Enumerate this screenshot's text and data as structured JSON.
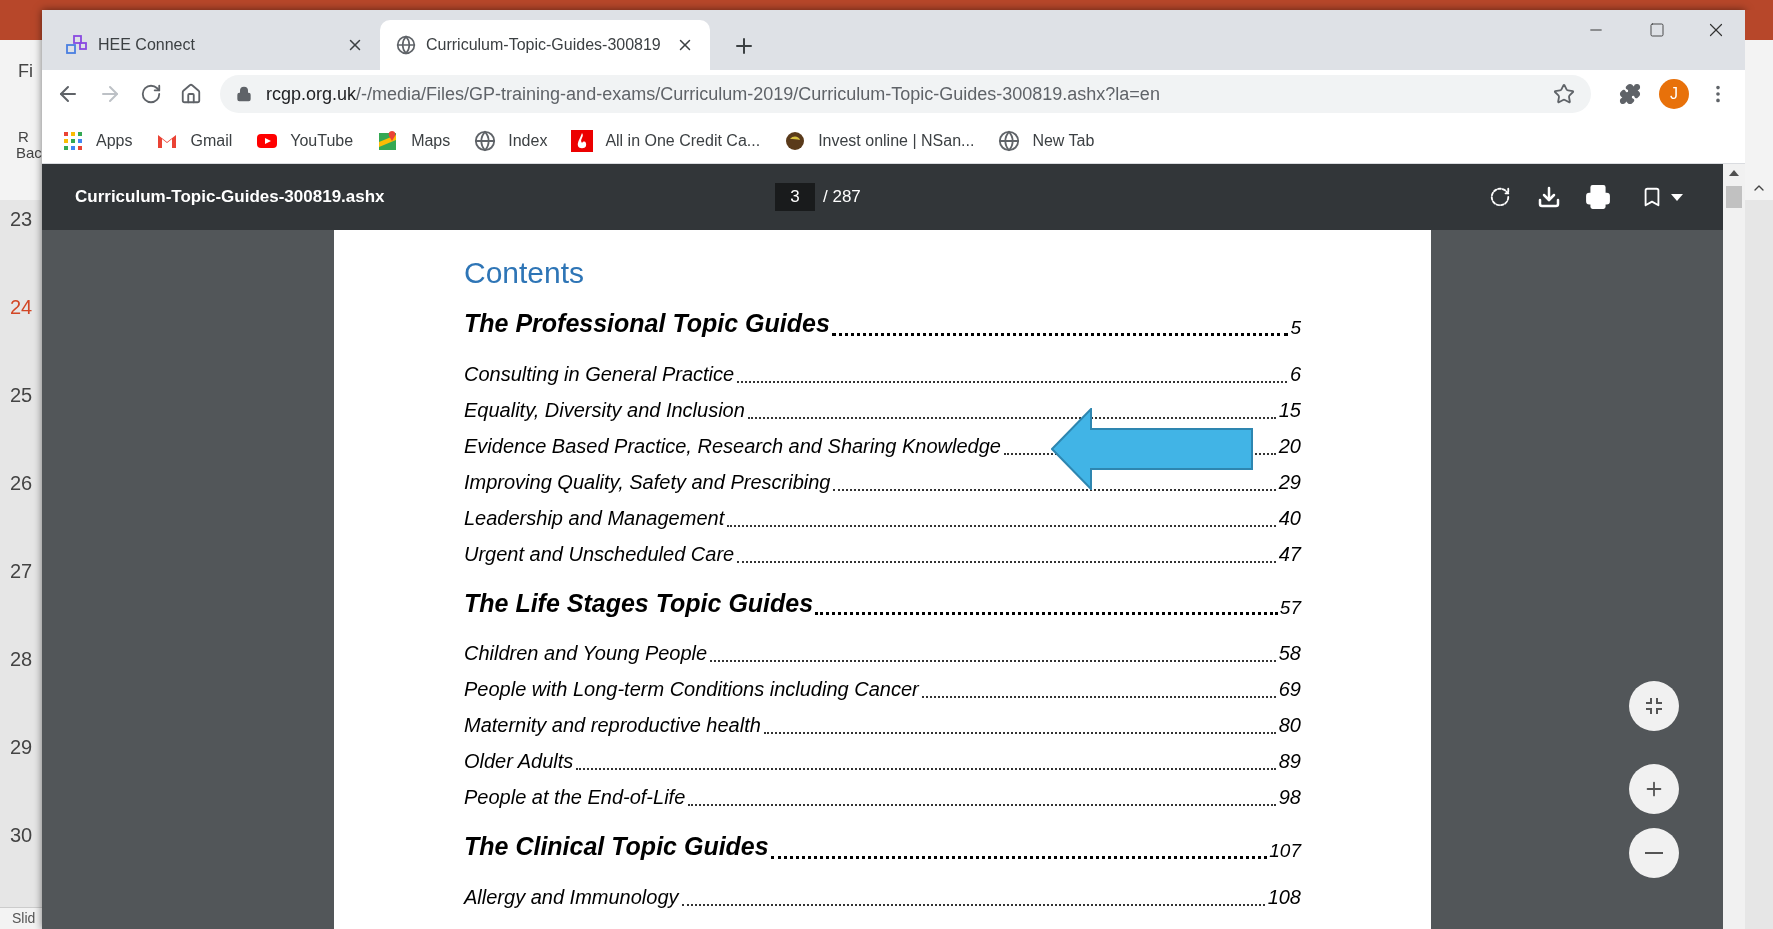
{
  "background_app": {
    "menu_fragments": [
      "Fi",
      "R",
      "Bac"
    ],
    "slide_numbers": [
      {
        "label": "23",
        "selected": false
      },
      {
        "label": "24",
        "selected": true
      },
      {
        "label": "25",
        "selected": false
      },
      {
        "label": "26",
        "selected": false
      },
      {
        "label": "27",
        "selected": false
      },
      {
        "label": "28",
        "selected": false
      },
      {
        "label": "29",
        "selected": false
      },
      {
        "label": "30",
        "selected": false
      }
    ],
    "status_fragment": "Slid"
  },
  "browser": {
    "tabs": [
      {
        "title": "HEE Connect",
        "kind": "app",
        "selected": false
      },
      {
        "title": "Curriculum-Topic-Guides-300819",
        "kind": "globe",
        "selected": true
      }
    ],
    "address": {
      "domain": "rcgp.org.uk",
      "path": "/-/media/Files/GP-training-and-exams/Curriculum-2019/Curriculum-Topic-Guides-300819.ashx?la=en"
    },
    "profile_initial": "J",
    "bookmarks": [
      {
        "label": "Apps",
        "kind": "apps"
      },
      {
        "label": "Gmail",
        "kind": "gmail"
      },
      {
        "label": "YouTube",
        "kind": "youtube"
      },
      {
        "label": "Maps",
        "kind": "maps"
      },
      {
        "label": "Index",
        "kind": "globe"
      },
      {
        "label": "All in One Credit Ca...",
        "kind": "flame"
      },
      {
        "label": "Invest online | NSan...",
        "kind": "seed"
      },
      {
        "label": "New Tab",
        "kind": "globe"
      }
    ]
  },
  "pdf_viewer": {
    "filename": "Curriculum-Topic-Guides-300819.ashx",
    "page": "3",
    "page_total": "/ 287",
    "contents_title": "Contents",
    "sections": [
      {
        "title": "The Professional Topic Guides",
        "page": "5",
        "entries": [
          {
            "title": "Consulting in General Practice",
            "page": "6"
          },
          {
            "title": "Equality, Diversity and Inclusion",
            "page": "15"
          },
          {
            "title": "Evidence Based Practice, Research and Sharing Knowledge",
            "page": "20"
          },
          {
            "title": "Improving Quality, Safety and Prescribing",
            "page": "29"
          },
          {
            "title": "Leadership and Management",
            "page": "40"
          },
          {
            "title": "Urgent and Unscheduled Care",
            "page": "47"
          }
        ]
      },
      {
        "title": "The Life Stages Topic Guides",
        "page": "57",
        "entries": [
          {
            "title": "Children and Young People",
            "page": "58"
          },
          {
            "title": "People with Long-term Conditions including Cancer",
            "page": "69"
          },
          {
            "title": "Maternity and reproductive health",
            "page": "80"
          },
          {
            "title": "Older Adults",
            "page": "89"
          },
          {
            "title": "People at the End-of-Life",
            "page": "98"
          }
        ]
      },
      {
        "title": "The Clinical Topic Guides",
        "page": "107",
        "entries": [
          {
            "title": "Allergy and Immunology",
            "page": "108"
          }
        ]
      }
    ]
  }
}
